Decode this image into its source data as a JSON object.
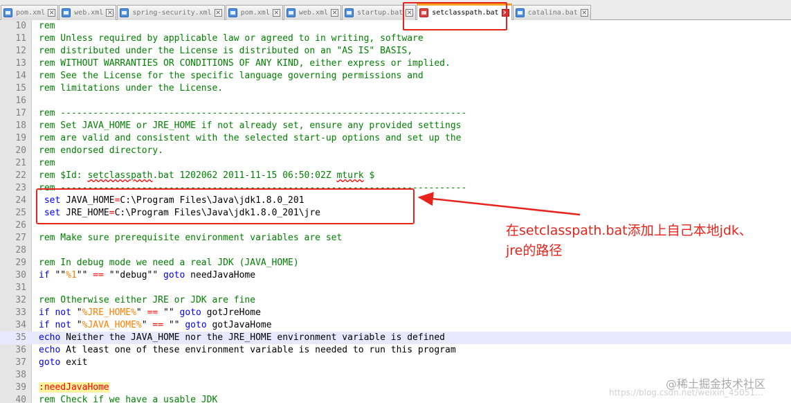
{
  "tabs": [
    {
      "label": "pom.xml",
      "active": false
    },
    {
      "label": "web.xml",
      "active": false
    },
    {
      "label": "spring-security.xml",
      "active": false
    },
    {
      "label": "pom.xml",
      "active": false
    },
    {
      "label": "web.xml",
      "active": false
    },
    {
      "label": "startup.bat",
      "active": false
    },
    {
      "label": "setclasspath.bat",
      "active": true
    },
    {
      "label": "catalina.bat",
      "active": false
    }
  ],
  "current_line": 35,
  "lines": [
    {
      "n": "10",
      "tokens": [
        {
          "t": "rem",
          "c": "comment"
        }
      ]
    },
    {
      "n": "11",
      "tokens": [
        {
          "t": "rem Unless required by applicable law or agreed to in writing, software",
          "c": "comment"
        }
      ]
    },
    {
      "n": "12",
      "tokens": [
        {
          "t": "rem distributed under the License is distributed on an \"AS IS\" BASIS,",
          "c": "comment"
        }
      ]
    },
    {
      "n": "13",
      "tokens": [
        {
          "t": "rem WITHOUT WARRANTIES OR CONDITIONS OF ANY KIND, either express or implied.",
          "c": "comment"
        }
      ]
    },
    {
      "n": "14",
      "tokens": [
        {
          "t": "rem See the License for the specific language governing permissions and",
          "c": "comment"
        }
      ]
    },
    {
      "n": "15",
      "tokens": [
        {
          "t": "rem limitations under the License.",
          "c": "comment"
        }
      ]
    },
    {
      "n": "16",
      "tokens": []
    },
    {
      "n": "17",
      "tokens": [
        {
          "t": "rem ---------------------------------------------------------------------------",
          "c": "comment"
        }
      ]
    },
    {
      "n": "18",
      "tokens": [
        {
          "t": "rem Set JAVA_HOME or JRE_HOME if not already set, ensure any provided settings",
          "c": "comment"
        }
      ]
    },
    {
      "n": "19",
      "tokens": [
        {
          "t": "rem are valid and consistent with the selected start-up options and set up the",
          "c": "comment"
        }
      ]
    },
    {
      "n": "20",
      "tokens": [
        {
          "t": "rem endorsed directory.",
          "c": "comment"
        }
      ]
    },
    {
      "n": "21",
      "tokens": [
        {
          "t": "rem",
          "c": "comment"
        }
      ]
    },
    {
      "n": "22",
      "tokens": [
        {
          "t": "rem $Id: ",
          "c": "comment"
        },
        {
          "t": "setclasspath",
          "c": "comment wavy"
        },
        {
          "t": ".bat 1202062 2011-11-15 06:50:02Z ",
          "c": "comment"
        },
        {
          "t": "mturk",
          "c": "comment wavy"
        },
        {
          "t": " $",
          "c": "comment"
        }
      ]
    },
    {
      "n": "23",
      "tokens": [
        {
          "t": "rem ---------------------------------------------------------------------------",
          "c": "comment"
        }
      ]
    },
    {
      "n": "24",
      "tokens": [
        {
          "t": " set",
          "c": "kw"
        },
        {
          "t": " JAVA_HOME",
          "c": "plain"
        },
        {
          "t": "=",
          "c": "op"
        },
        {
          "t": "C:\\Program Files\\Java\\jdk1.8.0_201",
          "c": "plain"
        }
      ]
    },
    {
      "n": "25",
      "tokens": [
        {
          "t": " set",
          "c": "kw"
        },
        {
          "t": " JRE_HOME",
          "c": "plain"
        },
        {
          "t": "=",
          "c": "op"
        },
        {
          "t": "C:\\Program Files\\Java\\jdk1.8.0_201\\jre",
          "c": "plain"
        }
      ]
    },
    {
      "n": "26",
      "tokens": []
    },
    {
      "n": "27",
      "tokens": [
        {
          "t": "rem Make sure prerequisite environment variables are set",
          "c": "comment"
        }
      ]
    },
    {
      "n": "28",
      "tokens": []
    },
    {
      "n": "29",
      "tokens": [
        {
          "t": "rem In debug mode we need a real JDK (JAVA_HOME)",
          "c": "comment"
        }
      ]
    },
    {
      "n": "30",
      "tokens": [
        {
          "t": "if",
          "c": "kw"
        },
        {
          "t": " \"\"",
          "c": "plain"
        },
        {
          "t": "%1",
          "c": "var"
        },
        {
          "t": "\"\" ",
          "c": "plain"
        },
        {
          "t": "==",
          "c": "op"
        },
        {
          "t": " \"\"debug\"\" ",
          "c": "plain"
        },
        {
          "t": "goto",
          "c": "kw"
        },
        {
          "t": " needJavaHome",
          "c": "plain"
        }
      ]
    },
    {
      "n": "31",
      "tokens": []
    },
    {
      "n": "32",
      "tokens": [
        {
          "t": "rem Otherwise either JRE or JDK are fine",
          "c": "comment"
        }
      ]
    },
    {
      "n": "33",
      "tokens": [
        {
          "t": "if not",
          "c": "kw"
        },
        {
          "t": " \"",
          "c": "plain"
        },
        {
          "t": "%JRE_HOME%",
          "c": "var"
        },
        {
          "t": "\" ",
          "c": "plain"
        },
        {
          "t": "==",
          "c": "op"
        },
        {
          "t": " \"\" ",
          "c": "plain"
        },
        {
          "t": "goto",
          "c": "kw"
        },
        {
          "t": " gotJreHome",
          "c": "plain"
        }
      ]
    },
    {
      "n": "34",
      "tokens": [
        {
          "t": "if not",
          "c": "kw"
        },
        {
          "t": " \"",
          "c": "plain"
        },
        {
          "t": "%JAVA_HOME%",
          "c": "var"
        },
        {
          "t": "\" ",
          "c": "plain"
        },
        {
          "t": "==",
          "c": "op"
        },
        {
          "t": " \"\" ",
          "c": "plain"
        },
        {
          "t": "goto",
          "c": "kw"
        },
        {
          "t": " gotJavaHome",
          "c": "plain"
        }
      ]
    },
    {
      "n": "35",
      "tokens": [
        {
          "t": "echo",
          "c": "kw"
        },
        {
          "t": " Neither the JAVA_HOME nor the JRE_HOME environment variable is defined",
          "c": "plain"
        }
      ]
    },
    {
      "n": "36",
      "tokens": [
        {
          "t": "echo",
          "c": "kw"
        },
        {
          "t": " At least one of these environment variable is needed to run this program",
          "c": "plain"
        }
      ]
    },
    {
      "n": "37",
      "tokens": [
        {
          "t": "goto",
          "c": "kw"
        },
        {
          "t": " exit",
          "c": "plain"
        }
      ]
    },
    {
      "n": "38",
      "tokens": []
    },
    {
      "n": "39",
      "tokens": [
        {
          "t": ":needJavaHome",
          "c": "lbl"
        }
      ]
    },
    {
      "n": "40",
      "tokens": [
        {
          "t": "rem Check if we have a usable JDK",
          "c": "comment"
        }
      ]
    }
  ],
  "annotation": {
    "line1": "在setclasspath.bat添加上自己本地jdk、",
    "line2": "jre的路径"
  },
  "watermark": "@稀土掘金技术社区",
  "watermark_url": "https://blog.csdn.net/weixin_45051..."
}
